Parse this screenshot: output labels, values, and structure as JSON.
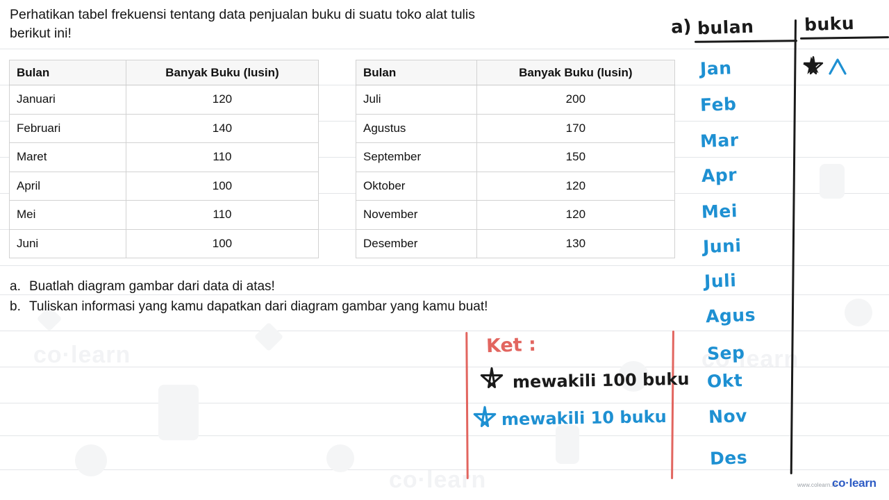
{
  "colors": {
    "handwriting_blue": "#1e90d2",
    "handwriting_black": "#1a1a1a",
    "handwriting_red": "#e2655f",
    "brand_blue": "#2d5bc4",
    "rule_line": "#e3e5e8",
    "table_header_bg": "#f7f7f7",
    "table_border": "#d2d2d2"
  },
  "prompt": {
    "line1": "Perhatikan tabel frekuensi tentang data penjualan buku di suatu toko alat tulis",
    "line2": "berikut ini!"
  },
  "table_left": {
    "headers": [
      "Bulan",
      "Banyak Buku (lusin)"
    ],
    "rows": [
      [
        "Januari",
        "120"
      ],
      [
        "Februari",
        "140"
      ],
      [
        "Maret",
        "110"
      ],
      [
        "April",
        "100"
      ],
      [
        "Mei",
        "110"
      ],
      [
        "Juni",
        "100"
      ]
    ]
  },
  "table_right": {
    "headers": [
      "Bulan",
      "Banyak Buku (lusin)"
    ],
    "rows": [
      [
        "Juli",
        "200"
      ],
      [
        "Agustus",
        "170"
      ],
      [
        "September",
        "150"
      ],
      [
        "Oktober",
        "120"
      ],
      [
        "November",
        "120"
      ],
      [
        "Desember",
        "130"
      ]
    ]
  },
  "questions": [
    {
      "mark": "a.",
      "text": "Buatlah diagram gambar dari data di atas!"
    },
    {
      "mark": "b.",
      "text": "Tuliskan informasi yang kamu dapatkan dari diagram gambar yang kamu buat!"
    }
  ],
  "answer": {
    "part_label": "a)",
    "head_month": "bulan",
    "head_books": "buku",
    "months": [
      "Jan",
      "Feb",
      "Mar",
      "Apr",
      "Mei",
      "Juni",
      "Juli",
      "Agus",
      "Sep",
      "Okt",
      "Nov",
      "Des"
    ],
    "jan_symbols": "★ ∧"
  },
  "legend": {
    "title": "Ket :",
    "line1": "mewakili 100 buku",
    "line2": "mewakili 10 buku",
    "star_black": "★",
    "star_blue": "★"
  },
  "chart_data": {
    "type": "table",
    "title": "Data penjualan buku di suatu toko alat tulis",
    "xlabel": "Bulan",
    "ylabel": "Banyak Buku (lusin)",
    "categories": [
      "Januari",
      "Februari",
      "Maret",
      "April",
      "Mei",
      "Juni",
      "Juli",
      "Agustus",
      "September",
      "Oktober",
      "November",
      "Desember"
    ],
    "values": [
      120,
      140,
      110,
      100,
      110,
      100,
      200,
      170,
      150,
      120,
      120,
      130
    ],
    "unit": "lusin",
    "legend": [
      "★ hitam mewakili 100 buku",
      "★ biru mewakili 10 buku"
    ]
  },
  "brand": {
    "url": "www.colearn.id",
    "name": "co·learn"
  }
}
